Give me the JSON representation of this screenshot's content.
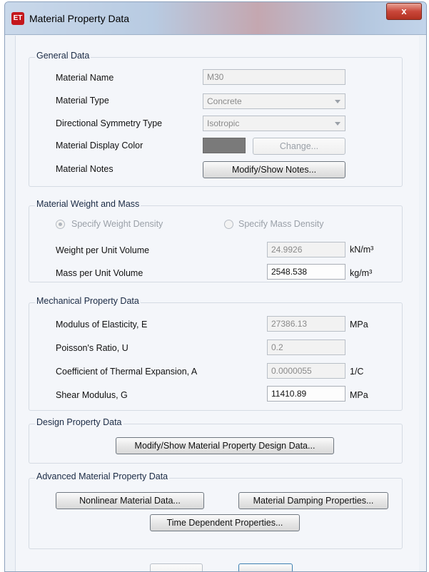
{
  "window": {
    "title": "Material Property Data",
    "app_icon": "ET",
    "close_glyph": "x"
  },
  "general": {
    "legend": "General Data",
    "material_name_label": "Material Name",
    "material_name_value": "M30",
    "material_type_label": "Material Type",
    "material_type_value": "Concrete",
    "symmetry_label": "Directional Symmetry Type",
    "symmetry_value": "Isotropic",
    "display_color_label": "Material Display Color",
    "display_color": "#7a7a7a",
    "change_button": "Change...",
    "notes_label": "Material Notes",
    "notes_button": "Modify/Show Notes..."
  },
  "weight_mass": {
    "legend": "Material Weight and Mass",
    "radio_weight": "Specify Weight Density",
    "radio_mass": "Specify Mass Density",
    "weight_label": "Weight per Unit Volume",
    "weight_value": "24.9926",
    "weight_unit": "kN/m³",
    "mass_label": "Mass per Unit Volume",
    "mass_value": "2548.538",
    "mass_unit": "kg/m³"
  },
  "mechanical": {
    "legend": "Mechanical Property Data",
    "elasticity_label": "Modulus of Elasticity,  E",
    "elasticity_value": "27386.13",
    "elasticity_unit": "MPa",
    "poisson_label": "Poisson's Ratio,  U",
    "poisson_value": "0.2",
    "thermal_label": "Coefficient of Thermal Expansion,  A",
    "thermal_value": "0.0000055",
    "thermal_unit": "1/C",
    "shear_label": "Shear Modulus,  G",
    "shear_value": "11410.89",
    "shear_unit": "MPa"
  },
  "design": {
    "legend": "Design Property Data",
    "button": "Modify/Show Material Property Design Data..."
  },
  "advanced": {
    "legend": "Advanced Material Property Data",
    "nonlinear_button": "Nonlinear Material Data...",
    "damping_button": "Material Damping Properties...",
    "time_button": "Time Dependent Properties..."
  }
}
